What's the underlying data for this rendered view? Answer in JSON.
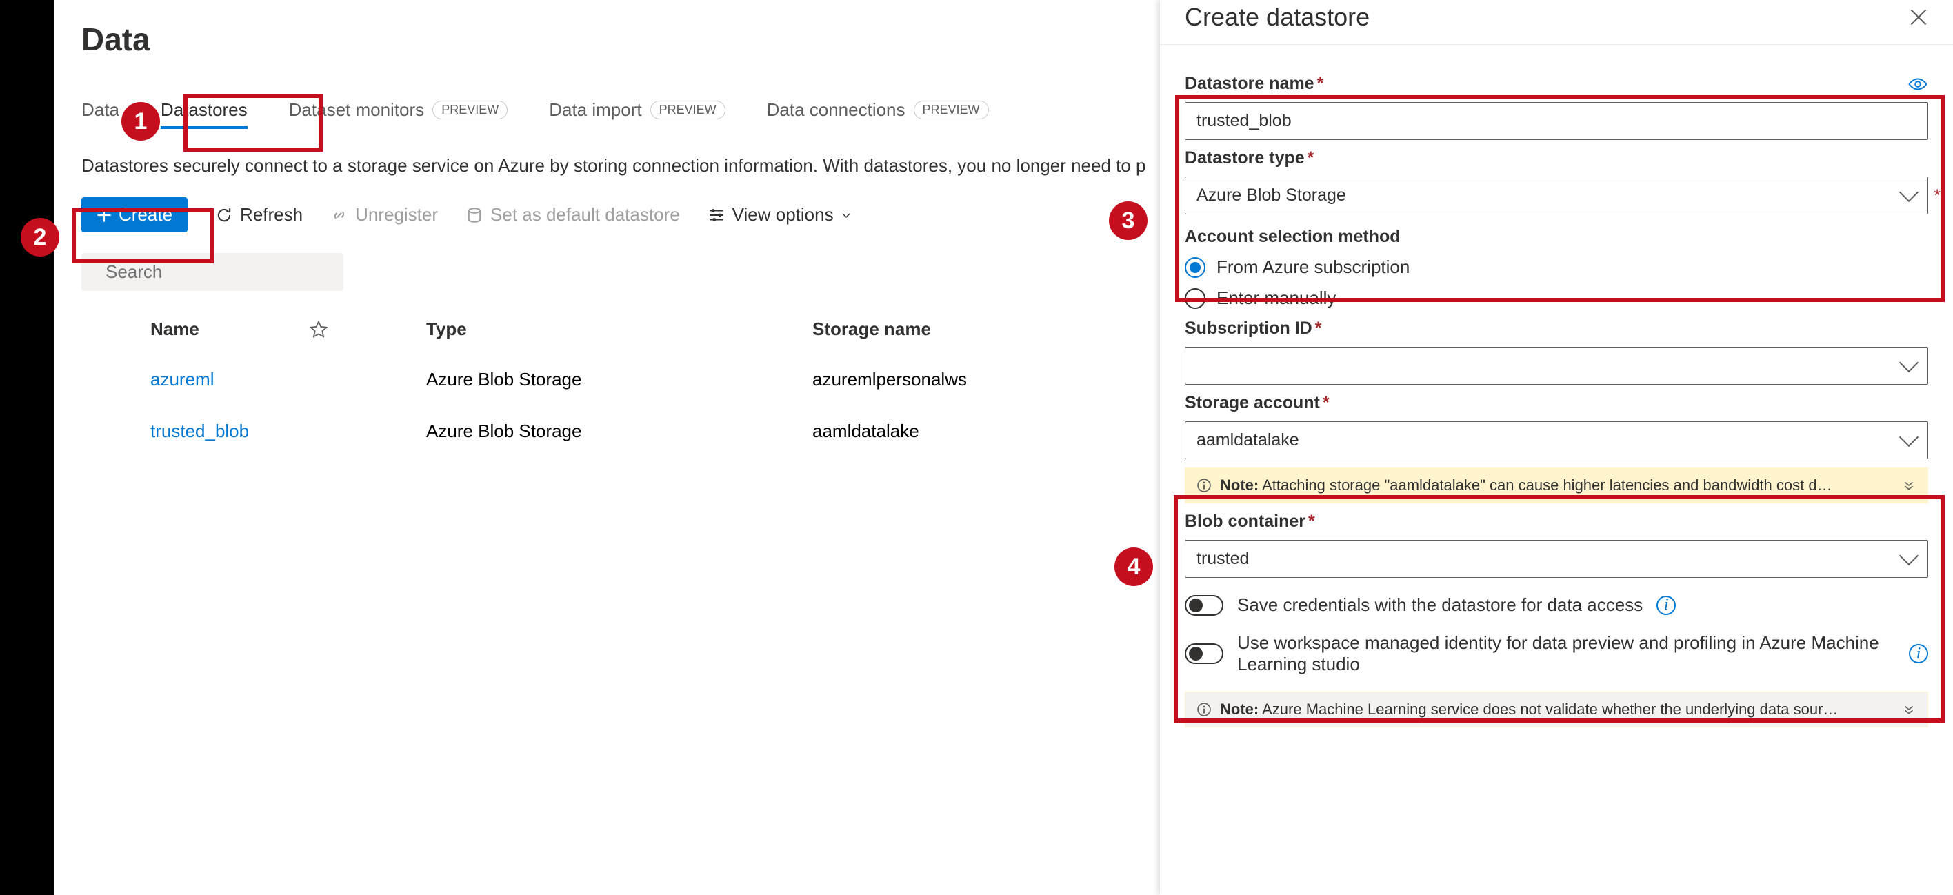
{
  "page": {
    "title": "Data",
    "description": "Datastores securely connect to a storage service on Azure by storing connection information. With datastores, you no longer need to p"
  },
  "tabs": {
    "data_assets": "Data",
    "datastores": "Datastores",
    "dataset_monitors": "Dataset monitors",
    "data_import": "Data import",
    "data_connections": "Data connections",
    "preview_badge": "PREVIEW"
  },
  "toolbar": {
    "create": "Create",
    "refresh": "Refresh",
    "unregister": "Unregister",
    "set_default": "Set as default datastore",
    "view_options": "View options"
  },
  "search": {
    "placeholder": "Search"
  },
  "table": {
    "headers": {
      "name": "Name",
      "type": "Type",
      "storage": "Storage name"
    },
    "rows": [
      {
        "name": "azureml",
        "type": "Azure Blob Storage",
        "storage": "azuremlpersonalws"
      },
      {
        "name": "trusted_blob",
        "type": "Azure Blob Storage",
        "storage": "aamldatalake"
      }
    ]
  },
  "panel": {
    "title": "Create datastore",
    "labels": {
      "datastore_name": "Datastore name",
      "datastore_type": "Datastore type",
      "account_selection": "Account selection method",
      "from_sub": "From Azure subscription",
      "enter_manually": "Enter manually",
      "subscription_id": "Subscription ID",
      "storage_account": "Storage account",
      "blob_container": "Blob container",
      "save_creds": "Save credentials with the datastore for data access",
      "managed_identity": "Use workspace managed identity for data preview and profiling in Azure Machine Learning studio"
    },
    "values": {
      "datastore_name": "trusted_blob",
      "datastore_type": "Azure Blob Storage",
      "subscription_id": "",
      "storage_account": "aamldatalake",
      "blob_container": "trusted"
    },
    "notes": {
      "note_label": "Note:",
      "storage_note": " Attaching storage \"aamldatalake\" can cause higher latencies and bandwidth cost d…",
      "validate_note": " Azure Machine Learning service does not validate whether the underlying data sour…"
    }
  },
  "callouts": {
    "1": "1",
    "2": "2",
    "3": "3",
    "4": "4"
  }
}
